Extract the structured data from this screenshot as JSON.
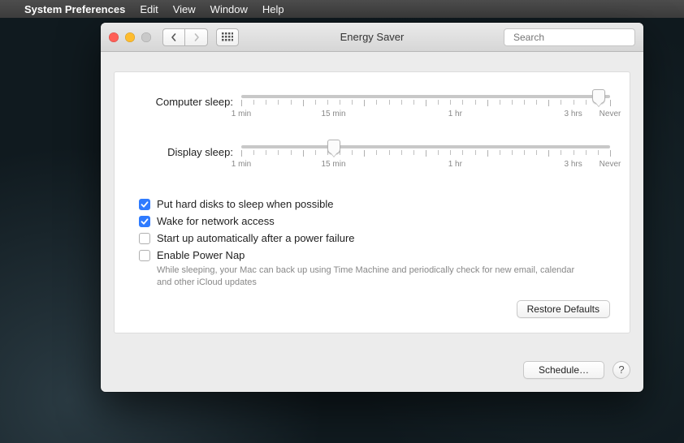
{
  "menubar": {
    "app": "System Preferences",
    "items": [
      "Edit",
      "View",
      "Window",
      "Help"
    ]
  },
  "window": {
    "title": "Energy Saver",
    "search_placeholder": "Search"
  },
  "sliders": {
    "computer": {
      "label": "Computer sleep:",
      "marks": [
        "1 min",
        "15 min",
        "1 hr",
        "3 hrs",
        "Never"
      ],
      "mark_positions": [
        0,
        25,
        58,
        90,
        100
      ],
      "value_pct": 97
    },
    "display": {
      "label": "Display sleep:",
      "marks": [
        "1 min",
        "15 min",
        "1 hr",
        "3 hrs",
        "Never"
      ],
      "mark_positions": [
        0,
        25,
        58,
        90,
        100
      ],
      "value_pct": 25
    }
  },
  "checks": {
    "hdd": {
      "label": "Put hard disks to sleep when possible",
      "checked": true
    },
    "wake": {
      "label": "Wake for network access",
      "checked": true
    },
    "powerfail": {
      "label": "Start up automatically after a power failure",
      "checked": false
    },
    "powernap": {
      "label": "Enable Power Nap",
      "checked": false,
      "helper": "While sleeping, your Mac can back up using Time Machine and periodically check for new email, calendar and other iCloud updates"
    }
  },
  "buttons": {
    "restore": "Restore Defaults",
    "schedule": "Schedule…",
    "help": "?"
  }
}
